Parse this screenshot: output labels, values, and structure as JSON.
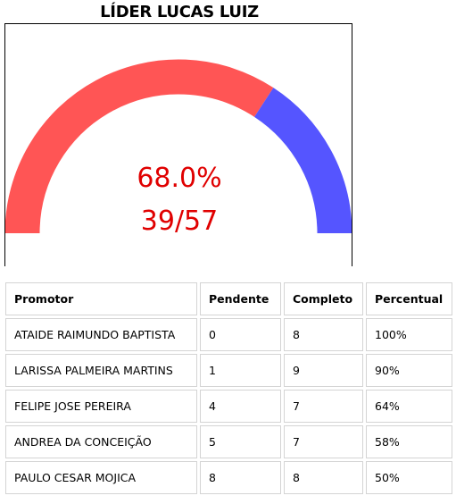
{
  "title": "LÍDER LUCAS LUIZ",
  "gauge": {
    "percent_label": "68.0%",
    "fraction_label": "39/57",
    "completed": 39,
    "total": 57,
    "percent": 68.0,
    "colors": {
      "filled": "#ff5555",
      "remaining": "#5555ff",
      "text": "#e00000"
    }
  },
  "table": {
    "headers": [
      "Promotor",
      "Pendente",
      "Completo",
      "Percentual"
    ],
    "rows": [
      [
        "ATAIDE RAIMUNDO BAPTISTA",
        "0",
        "8",
        "100%"
      ],
      [
        "LARISSA PALMEIRA MARTINS",
        "1",
        "9",
        "90%"
      ],
      [
        "FELIPE JOSE PEREIRA",
        "4",
        "7",
        "64%"
      ],
      [
        "ANDREA DA CONCEIÇÃO",
        "5",
        "7",
        "58%"
      ],
      [
        "PAULO CESAR MOJICA",
        "8",
        "8",
        "50%"
      ]
    ]
  }
}
